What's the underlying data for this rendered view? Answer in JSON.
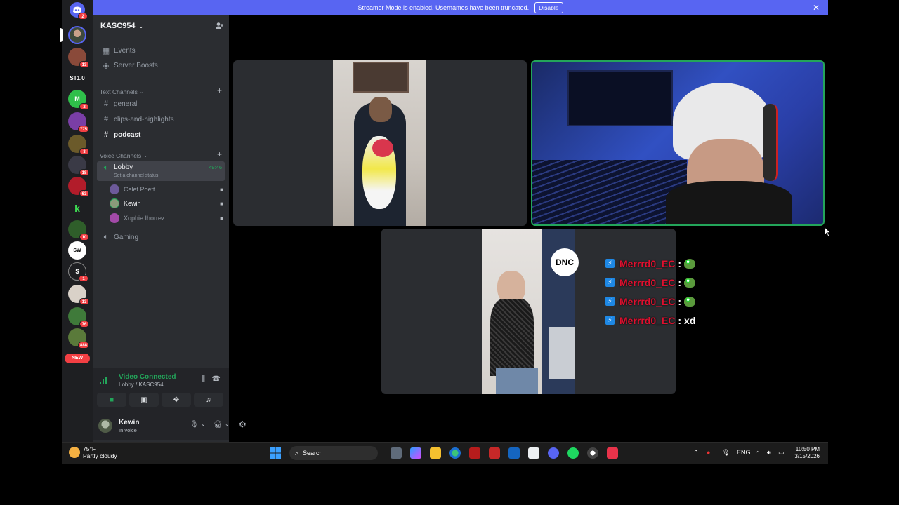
{
  "banner": {
    "text": "Streamer Mode is enabled. Usernames have been truncated.",
    "disable_label": "Disable"
  },
  "rail": {
    "badges": [
      "2",
      "13",
      "2",
      "775",
      "3",
      "18",
      "63",
      "10",
      "1",
      "13",
      "76",
      "888"
    ],
    "st_label": "ST1.0",
    "new_label": "NEW"
  },
  "guild": {
    "name": "KASC954"
  },
  "channels": {
    "top": [
      {
        "label": "Events"
      },
      {
        "label": "Server Boosts"
      }
    ],
    "text_category": "Text Channels",
    "text": [
      {
        "label": "general"
      },
      {
        "label": "clips-and-highlights"
      },
      {
        "label": "podcast"
      }
    ],
    "voice_category": "Voice Channels",
    "lobby": {
      "label": "Lobby",
      "timer": "49:46",
      "status": "Set a channel status"
    },
    "members": [
      {
        "name": "Celef Poett"
      },
      {
        "name": "Kewin"
      },
      {
        "name": "Xophie Ihorrez"
      }
    ],
    "gaming": {
      "label": "Gaming"
    }
  },
  "voice_panel": {
    "title": "Video Connected",
    "subtitle": "Lobby / KASC954"
  },
  "user": {
    "name": "Kewin",
    "status": "In voice"
  },
  "chat": [
    {
      "name": "Merrrd0_EC",
      "sep": ":",
      "msg": "",
      "emote": "pepe-emote"
    },
    {
      "name": "Merrrd0_EC",
      "sep": ":",
      "msg": "",
      "emote": "pepe-emote"
    },
    {
      "name": "Merrrd0_EC",
      "sep": ":",
      "msg": "",
      "emote": "pepe-emote"
    },
    {
      "name": "Merrrd0_EC",
      "sep": ":",
      "msg": "xd",
      "emote": ""
    }
  ],
  "taskbar": {
    "weather_temp": "75°F",
    "weather_desc": "Partly cloudy",
    "search_label": "Search",
    "lang": "ENG",
    "time": "10:50 PM",
    "date": "3/15/2026"
  },
  "colors": {
    "accent": "#5865f2",
    "speaking": "#23a55a",
    "badge": "#f23f43",
    "chat_name": "#e0102f"
  }
}
